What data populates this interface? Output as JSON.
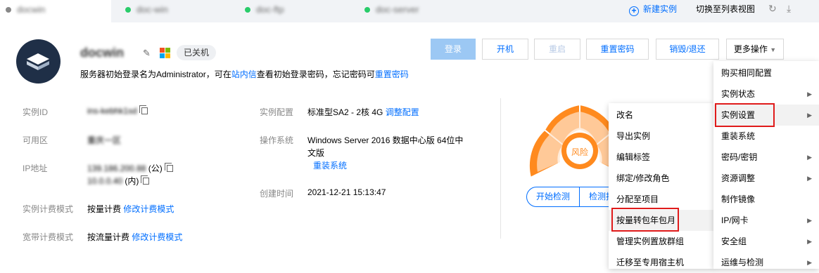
{
  "tabs": {
    "active": "docwin",
    "items": [
      "doc-win",
      "doc-ftp",
      "doc-server"
    ],
    "new_instance": "新建实例",
    "switch_list": "切换至列表视图"
  },
  "header": {
    "name": "docwin",
    "status": "已关机",
    "hint_prefix": "服务器初始登录名为Administrator，可在",
    "hint_link1": "站内信",
    "hint_middle": "查看初始登录密码，忘记密码可",
    "hint_link2": "重置密码"
  },
  "actions": {
    "login": "登录",
    "start": "开机",
    "restart": "重启",
    "reset_pwd": "重置密码",
    "terminate": "销毁/退还",
    "more": "更多操作"
  },
  "info": {
    "instance_id_label": "实例ID",
    "instance_id": "ins-kebhk1sd",
    "zone_label": "可用区",
    "zone": "重庆一区",
    "ip_label": "IP地址",
    "ip_public": "139.186.200.88",
    "ip_public_tag": "(公)",
    "ip_private": "10.0.0.40",
    "ip_private_tag": "(内)",
    "billing_label": "实例计费模式",
    "billing": "按量计费",
    "billing_link": "修改计费模式",
    "bandwidth_label": "宽带计费模式",
    "bandwidth": "按流量计费",
    "bandwidth_link": "修改计费模式",
    "config_label": "实例配置",
    "config": "标准型SA2 - 2核 4G",
    "config_link": "调整配置",
    "os_label": "操作系统",
    "os_line1": "Windows Server 2016 数据中心版 64位中",
    "os_line2": "文版",
    "os_link": "重装系统",
    "created_label": "创建时间",
    "created": "2021-12-21 15:13:47"
  },
  "health": {
    "level": "风险",
    "start_check": "开始检测",
    "check_report": "检测报告"
  },
  "more_menu": [
    {
      "label": "购买相同配置",
      "sub": false
    },
    {
      "label": "实例状态",
      "sub": true
    },
    {
      "label": "实例设置",
      "sub": true
    },
    {
      "label": "重装系统",
      "sub": false
    },
    {
      "label": "密码/密钥",
      "sub": true
    },
    {
      "label": "资源调整",
      "sub": true
    },
    {
      "label": "制作镜像",
      "sub": false
    },
    {
      "label": "IP/网卡",
      "sub": true
    },
    {
      "label": "安全组",
      "sub": true
    },
    {
      "label": "运维与检测",
      "sub": true
    }
  ],
  "settings_menu": [
    "改名",
    "导出实例",
    "编辑标签",
    "绑定/修改角色",
    "分配至项目",
    "按量转包年包月",
    "管理实例置放群组",
    "迁移至专用宿主机"
  ],
  "colors": {
    "accent": "#006eff",
    "risk_orange": "#ff8a1e",
    "highlight_red": "#e01b1b"
  }
}
